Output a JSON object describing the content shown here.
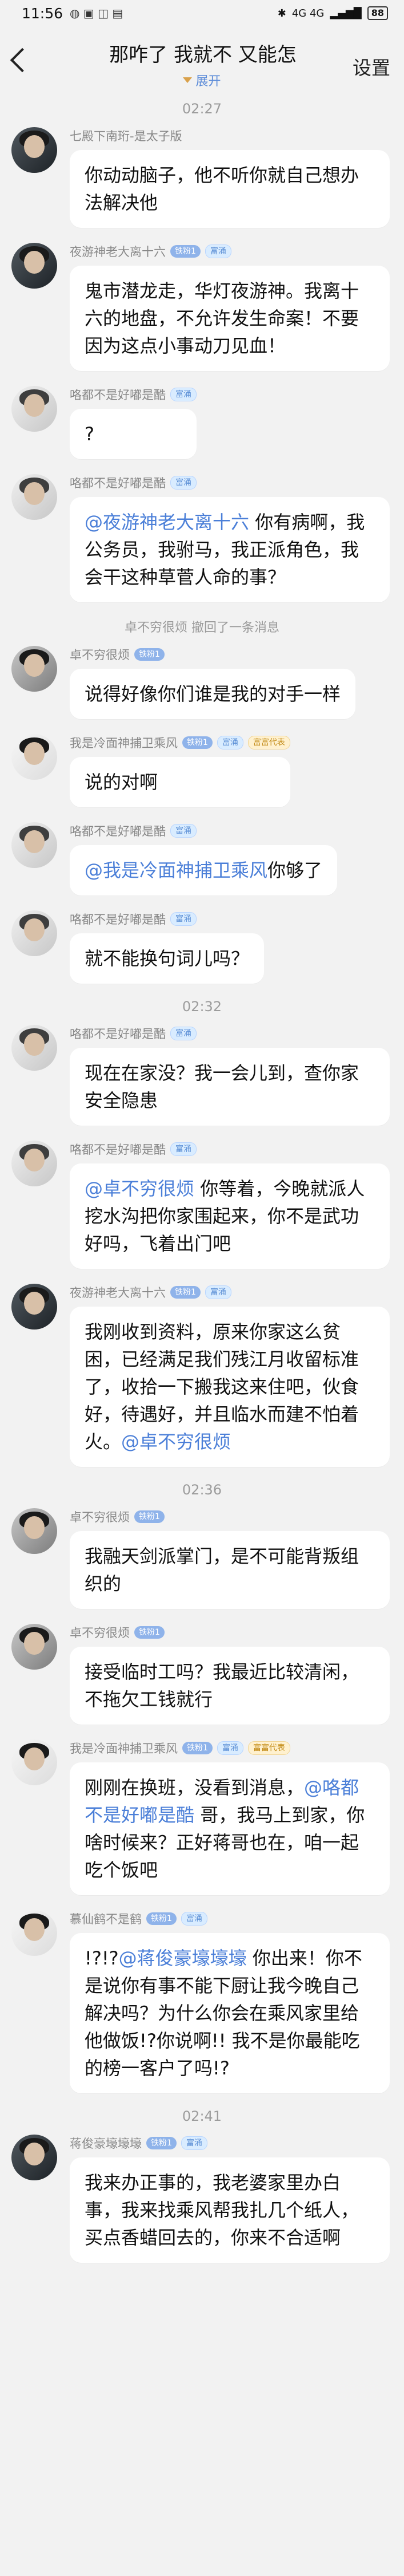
{
  "statusbar": {
    "time": "11:56",
    "network": "4G 4G",
    "battery": "88"
  },
  "header": {
    "title": "那咋了 我就不 又能怎",
    "expand_label": "展开",
    "settings_label": "设置"
  },
  "messages": [
    {
      "type": "time",
      "text": "02:27"
    },
    {
      "type": "msg",
      "name": "七殿下南珩-是太子版",
      "badges": [],
      "text": "你动动脑子，他不听你就自己想办法解决他"
    },
    {
      "type": "msg",
      "name": "夜游神老大离十六",
      "badges": [
        {
          "text": "铁粉1",
          "cls": ""
        },
        {
          "text": "富涌",
          "cls": "admin"
        }
      ],
      "text": "鬼市潜龙走，华灯夜游神。我离十六的地盘，不允许发生命案！不要因为这点小事动刀见血！"
    },
    {
      "type": "msg",
      "name": "咯都不是好嘟是酷",
      "badges": [
        {
          "text": "富涌",
          "cls": "admin"
        }
      ],
      "text": "?"
    },
    {
      "type": "msg",
      "name": "咯都不是好嘟是酷",
      "badges": [
        {
          "text": "富涌",
          "cls": "admin"
        }
      ],
      "mention": "@夜游神老大离十六",
      "text": " 你有病啊，我公务员，我驸马，我正派角色，我会干这种草菅人命的事？"
    },
    {
      "type": "note",
      "text": "卓不穷很烦 撤回了一条消息"
    },
    {
      "type": "msg",
      "name": "卓不穷很烦",
      "badges": [
        {
          "text": "铁粉1",
          "cls": ""
        }
      ],
      "text": "说得好像你们谁是我的对手一样"
    },
    {
      "type": "msg",
      "name": "我是冷面神捕卫乘风",
      "badges": [
        {
          "text": "铁粉1",
          "cls": ""
        },
        {
          "text": "富涌",
          "cls": "admin"
        },
        {
          "text": "富富代表",
          "cls": "gold"
        }
      ],
      "text": "说的对啊"
    },
    {
      "type": "msg",
      "name": "咯都不是好嘟是酷",
      "badges": [
        {
          "text": "富涌",
          "cls": "admin"
        }
      ],
      "mention": "@我是冷面神捕卫乘风",
      "text": "你够了 "
    },
    {
      "type": "msg",
      "name": "咯都不是好嘟是酷",
      "badges": [
        {
          "text": "富涌",
          "cls": "admin"
        }
      ],
      "text": "就不能换句词儿吗？"
    },
    {
      "type": "time",
      "text": "02:32"
    },
    {
      "type": "msg",
      "name": "咯都不是好嘟是酷",
      "badges": [
        {
          "text": "富涌",
          "cls": "admin"
        }
      ],
      "text": "现在在家没？我一会儿到，查你家安全隐患"
    },
    {
      "type": "msg",
      "name": "咯都不是好嘟是酷",
      "badges": [
        {
          "text": "富涌",
          "cls": "admin"
        }
      ],
      "mention": "@卓不穷很烦",
      "text": " 你等着，今晚就派人挖水沟把你家围起来，你不是武功好吗，飞着出门吧"
    },
    {
      "type": "msg",
      "name": "夜游神老大离十六",
      "badges": [
        {
          "text": "铁粉1",
          "cls": ""
        },
        {
          "text": "富涌",
          "cls": "admin"
        }
      ],
      "text": "我刚收到资料，原来你家这么贫困，已经满足我们残江月收留标准了，收拾一下搬我这来住吧，伙食好，待遇好，并且临水而建不怕着火。",
      "mention_end": "@卓不穷很烦"
    },
    {
      "type": "time",
      "text": "02:36"
    },
    {
      "type": "msg",
      "name": "卓不穷很烦",
      "badges": [
        {
          "text": "铁粉1",
          "cls": ""
        }
      ],
      "text": "我融天剑派掌门，是不可能背叛组织的"
    },
    {
      "type": "msg",
      "name": "卓不穷很烦",
      "badges": [
        {
          "text": "铁粉1",
          "cls": ""
        }
      ],
      "text": "接受临时工吗？我最近比较清闲，不拖欠工钱就行"
    },
    {
      "type": "msg",
      "name": "我是冷面神捕卫乘风",
      "badges": [
        {
          "text": "铁粉1",
          "cls": ""
        },
        {
          "text": "富涌",
          "cls": "admin"
        },
        {
          "text": "富富代表",
          "cls": "gold"
        }
      ],
      "text_before": "刚刚在换班，没看到消息，",
      "mention": "@咯都不是好嘟是酷",
      "text": " 哥，我马上到家，你啥时候来？正好蒋哥也在，咱一起吃个饭吧"
    },
    {
      "type": "msg",
      "name": "慕仙鹤不是鹤",
      "badges": [
        {
          "text": "铁粉1",
          "cls": ""
        },
        {
          "text": "富涌",
          "cls": "admin"
        }
      ],
      "text_before": "!?!?",
      "mention": "@蒋俊豪壕壕壕",
      "text": " 你出来！你不是说你有事不能下厨让我今晚自己解决吗？为什么你会在乘风家里给他做饭!?你说啊!! 我不是你最能吃的榜一客户了吗!?"
    },
    {
      "type": "time",
      "text": "02:41"
    },
    {
      "type": "msg",
      "name": "蒋俊豪壕壕壕",
      "badges": [
        {
          "text": "铁粉1",
          "cls": ""
        },
        {
          "text": "富涌",
          "cls": "admin"
        }
      ],
      "text": "我来办正事的，我老婆家里办白事，我来找乘风帮我扎几个纸人，买点香蜡回去的，你来不合适啊"
    }
  ]
}
